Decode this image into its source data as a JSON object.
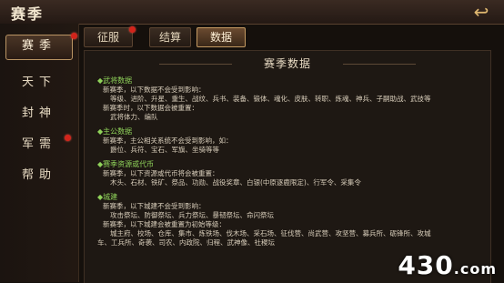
{
  "window": {
    "title": "赛季"
  },
  "sidebar": {
    "items": [
      {
        "label": "赛季",
        "active": true,
        "dot": true
      },
      {
        "label": "天下",
        "active": false,
        "dot": false
      },
      {
        "label": "封神",
        "active": false,
        "dot": false
      },
      {
        "label": "军需",
        "active": false,
        "dot": true
      },
      {
        "label": "帮助",
        "active": false,
        "dot": false
      }
    ]
  },
  "tabs": [
    {
      "label": "征服",
      "active": false,
      "dot": true
    },
    {
      "label": "结算",
      "active": false,
      "dot": false
    },
    {
      "label": "数据",
      "active": true,
      "dot": false
    }
  ],
  "panel": {
    "title": "赛季数据",
    "sections": [
      {
        "head": "◆武将数据",
        "lines": [
          {
            "text": "新赛季，以下数据不会受到影响：",
            "indent": 0
          },
          {
            "text": "等级、进阶、升星、重生、战纹、兵书、装备、锻体、魂化、皮肤、转职、炼魂、神兵、子嗣助战、武技等",
            "indent": 1
          },
          {
            "text": "新赛季时，以下数据会被重置：",
            "indent": 0
          },
          {
            "text": "武将体力、编队",
            "indent": 1
          }
        ]
      },
      {
        "head": "◆主公数据",
        "lines": [
          {
            "text": "新赛季，主公相关系统不会受到影响，如：",
            "indent": 0
          },
          {
            "text": "爵位、兵符、宝石、军旗、坐骑等等",
            "indent": 1
          }
        ]
      },
      {
        "head": "◆赛季资源或代币",
        "lines": [
          {
            "text": "新赛季，以下资源或代币将会被重置：",
            "indent": 0
          },
          {
            "text": "木头、石材、铁矿、祭品、功勋、战役奖章、白银(中原逐鹿限定)、行军令、采集令",
            "indent": 1
          }
        ]
      },
      {
        "head": "◆城建",
        "lines": [
          {
            "text": "新赛季，以下城建不会受到影响：",
            "indent": 0
          },
          {
            "text": "攻击祭坛、防御祭坛、兵力祭坛、暴韧祭坛、命闪祭坛",
            "indent": 1
          },
          {
            "text": "新赛季，以下城建会被重置为初始等级：",
            "indent": 0
          },
          {
            "text": "城主府、校场、仓库、集市、炼铁场、伐木场、采石场、征伐营、尚武营、攻坚营、募兵所、砺锋所、攻城",
            "indent": 1
          },
          {
            "text": "车、工兵所、奇袭、司农、内政院、归程、武神像、社稷坛",
            "indent": -1
          }
        ]
      }
    ]
  },
  "watermark": {
    "text": "430",
    "suffix": ".com"
  },
  "colors": {
    "accent": "#c49a62",
    "section_head": "#8fd25a",
    "badge": "#d2241b"
  }
}
